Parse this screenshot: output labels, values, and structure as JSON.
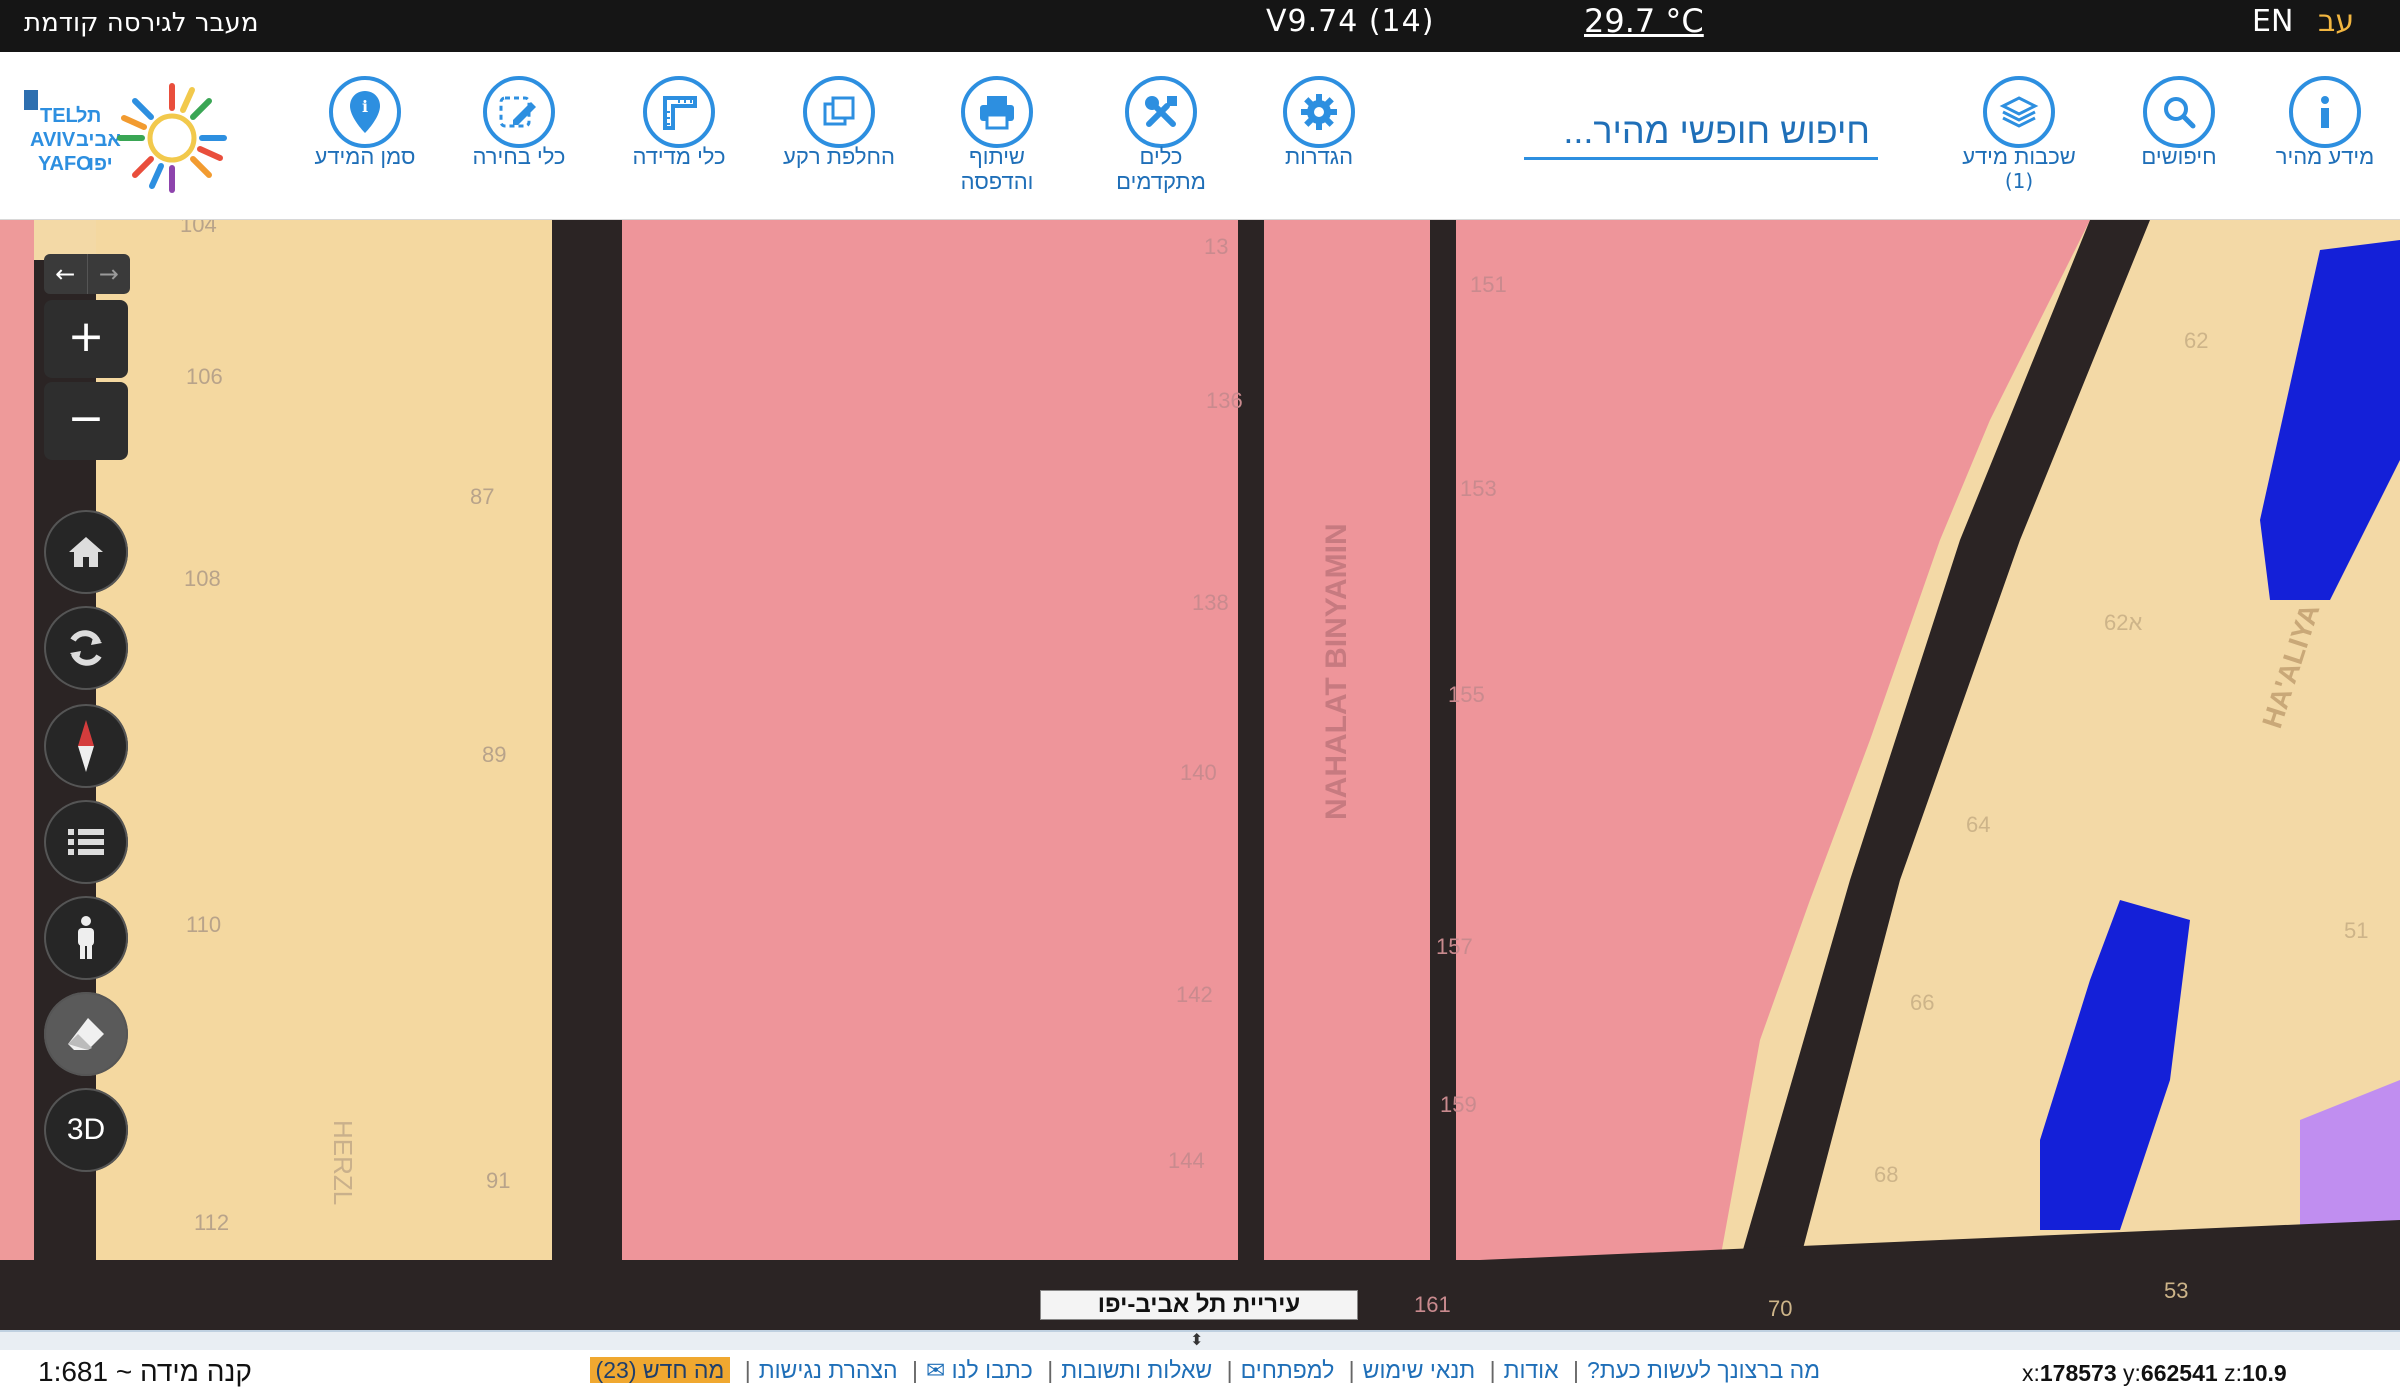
{
  "topbar": {
    "prev_version_label": "מעבר לגירסה קודמת",
    "version": "V9.74 (14)",
    "temperature": "29.7 °C",
    "lang_en": "EN",
    "lang_he": "עב"
  },
  "toolbar": {
    "quick_info": "מידע מהיר",
    "searches": "חיפושים",
    "layers": "שכבות מידע",
    "layers_count": "(1)",
    "search_placeholder": "חיפוש חופשי מהיר...",
    "settings": "הגדרות",
    "advanced_tools_1": "כלים",
    "advanced_tools_2": "מתקדמים",
    "share_print_1": "שיתוף",
    "share_print_2": "והדפסה",
    "basemap": "החלפת רקע",
    "measure": "כלי מדידה",
    "select": "כלי בחירה",
    "info_marker": "סמן המידע"
  },
  "map": {
    "streets": [
      "HERZL",
      "NAHALAT BINYAMIN",
      "HA'ALIYA"
    ],
    "house_numbers": [
      "104",
      "106",
      "87",
      "108",
      "89",
      "110",
      "91",
      "112",
      "13",
      "136",
      "138",
      "140",
      "142",
      "144",
      "151",
      "153",
      "155",
      "157",
      "159",
      "161",
      "62",
      "62א",
      "64",
      "66",
      "68",
      "70",
      "53",
      "51"
    ],
    "zoom_in": "+",
    "zoom_out": "−",
    "three_d": "3D",
    "credit": "עיריית תל אביב-יפו"
  },
  "footer": {
    "x_label": "x:",
    "x_value": "178573",
    "y_label": "y:",
    "y_value": "662541",
    "z_label": "z:",
    "z_value": "10.9",
    "links": {
      "what_now": "מה ברצונך לעשות כעת?",
      "about": "אודות",
      "terms": "תנאי שימוש",
      "developers": "למפתחים",
      "faq": "שאלות ותשובות",
      "write_us": "כתבו לנו ✉",
      "accessibility": "הצהרת נגישות",
      "whats_new": "מה חדש (23)"
    },
    "scale": "קנה מידה ~ 1:681"
  }
}
